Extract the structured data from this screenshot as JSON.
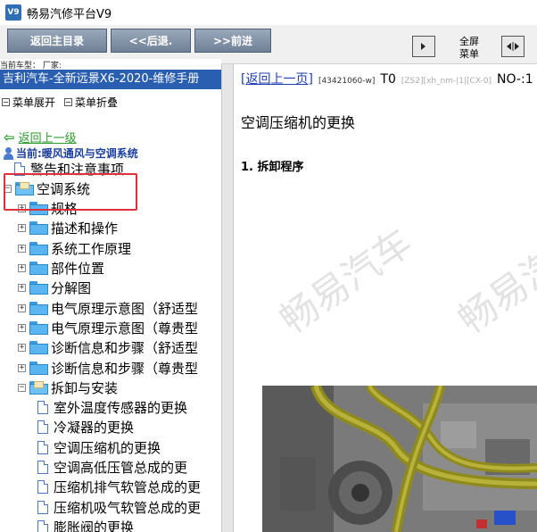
{
  "window": {
    "title": "畅易汽修平台V9"
  },
  "toolbar": {
    "back_main": "返回主目录",
    "prev": "<<后退.",
    "next": ">>前进",
    "fullscreen_line1": "全屏",
    "fullscreen_line2": "菜单"
  },
  "left": {
    "car_label": "当前车型：  厂家:",
    "manual_title": "吉利汽车-全新远景X6-2020-维修手册",
    "menu_expand": "菜单展开",
    "menu_collapse": "菜单折叠",
    "back_up": "返回上一级",
    "current": "当前:暖风通风与空调系统"
  },
  "tree": [
    {
      "label": "警告和注意事项",
      "type": "doc",
      "level": 1
    },
    {
      "label": "空调系统",
      "type": "folder-open",
      "level": 0
    },
    {
      "label": "规格",
      "type": "folder",
      "level": 1
    },
    {
      "label": "描述和操作",
      "type": "folder",
      "level": 1
    },
    {
      "label": "系统工作原理",
      "type": "folder",
      "level": 1
    },
    {
      "label": "部件位置",
      "type": "folder",
      "level": 1
    },
    {
      "label": "分解图",
      "type": "folder",
      "level": 1
    },
    {
      "label": "电气原理示意图（舒适型",
      "type": "folder",
      "level": 1
    },
    {
      "label": "电气原理示意图（尊贵型",
      "type": "folder",
      "level": 1
    },
    {
      "label": "诊断信息和步骤（舒适型",
      "type": "folder",
      "level": 1
    },
    {
      "label": "诊断信息和步骤（尊贵型",
      "type": "folder",
      "level": 1
    },
    {
      "label": "拆卸与安装",
      "type": "folder-open",
      "level": 1
    },
    {
      "label": "室外温度传感器的更换",
      "type": "doc",
      "level": 2
    },
    {
      "label": "冷凝器的更换",
      "type": "doc",
      "level": 2
    },
    {
      "label": "空调压缩机的更换",
      "type": "doc",
      "level": 2
    },
    {
      "label": "空调高低压管总成的更",
      "type": "doc",
      "level": 2
    },
    {
      "label": "压缩机排气软管总成的更",
      "type": "doc",
      "level": 2
    },
    {
      "label": "压缩机吸气软管总成的更",
      "type": "doc",
      "level": 2
    },
    {
      "label": "膨胀阀的更换",
      "type": "doc",
      "level": 2
    }
  ],
  "right": {
    "back_link": "[返回上一页]",
    "code1": "[43421060-w]",
    "code1b": "T0",
    "code2": "[ZS2][xh_nm-|1|[CX-0]",
    "code3": "NO-:1",
    "title": "空调压缩机的更换",
    "step": "1. 拆卸程序",
    "watermark": "畅易汽车"
  },
  "icons": {
    "app": "app-icon",
    "expand": "expand-all-icon",
    "collapse": "collapse-all-icon",
    "back": "green-left-arrow-icon",
    "current": "user-icon"
  }
}
